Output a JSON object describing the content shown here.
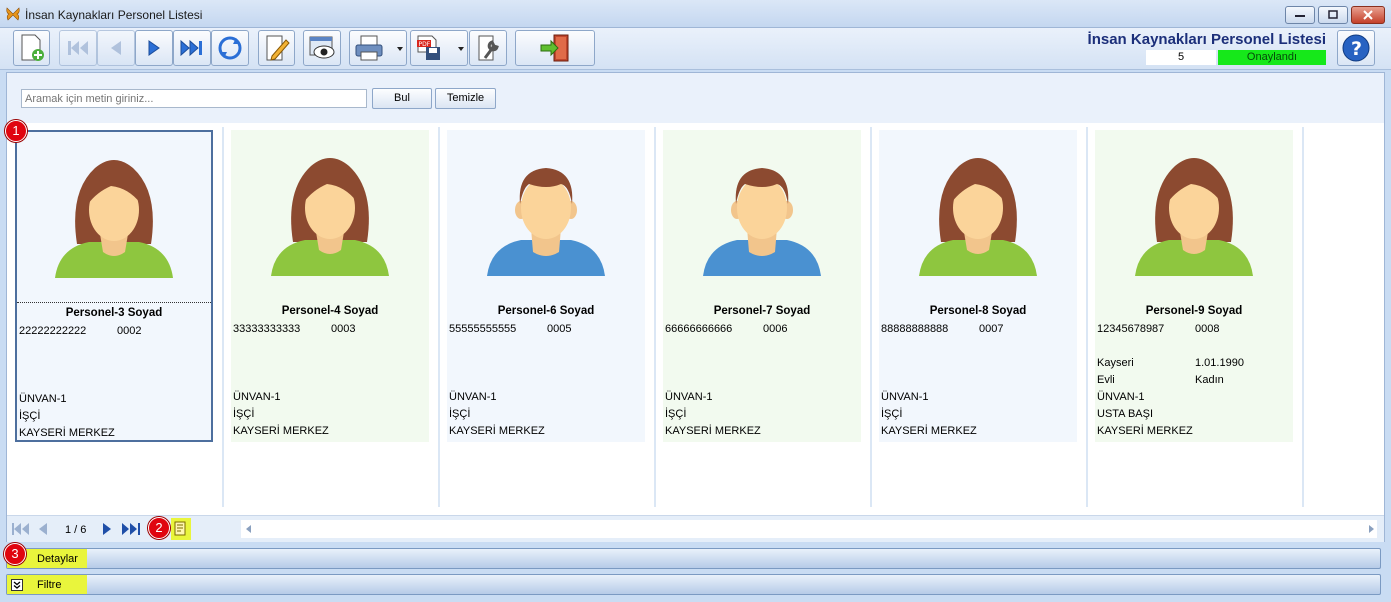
{
  "window": {
    "title": "İnsan Kaynakları Personel Listesi"
  },
  "header": {
    "heading": "İnsan Kaynakları Personel Listesi",
    "record_number": "5",
    "status": "Onaylandı"
  },
  "toolbar": {
    "buttons": [
      "new-record",
      "first",
      "previous",
      "next",
      "last",
      "refresh",
      "edit",
      "preview",
      "print",
      "pdf-export",
      "settings",
      "exit"
    ]
  },
  "search": {
    "placeholder": "Aramak için metin giriniz...",
    "find_label": "Bul",
    "clear_label": "Temizle"
  },
  "cards": [
    {
      "name": "Personel-3 Soyad",
      "id_no": "22222222222",
      "code": "0002",
      "city": "",
      "date": "",
      "marital": "",
      "gender": "",
      "title": "ÜNVAN-1",
      "position": "İŞÇİ",
      "department": "KAYSERİ MERKEZ",
      "avatar": "female-avatar-icon"
    },
    {
      "name": "Personel-4 Soyad",
      "id_no": "33333333333",
      "code": "0003",
      "city": "",
      "date": "",
      "marital": "",
      "gender": "",
      "title": "ÜNVAN-1",
      "position": "İŞÇİ",
      "department": "KAYSERİ MERKEZ",
      "avatar": "female-avatar-icon"
    },
    {
      "name": "Personel-6 Soyad",
      "id_no": "55555555555",
      "code": "0005",
      "city": "",
      "date": "",
      "marital": "",
      "gender": "",
      "title": "ÜNVAN-1",
      "position": "İŞÇİ",
      "department": "KAYSERİ MERKEZ",
      "avatar": "male-avatar-icon"
    },
    {
      "name": "Personel-7 Soyad",
      "id_no": "66666666666",
      "code": "0006",
      "city": "",
      "date": "",
      "marital": "",
      "gender": "",
      "title": "ÜNVAN-1",
      "position": "İŞÇİ",
      "department": "KAYSERİ MERKEZ",
      "avatar": "male-avatar-icon"
    },
    {
      "name": "Personel-8 Soyad",
      "id_no": "88888888888",
      "code": "0007",
      "city": "",
      "date": "",
      "marital": "",
      "gender": "",
      "title": "ÜNVAN-1",
      "position": "İŞÇİ",
      "department": "KAYSERİ MERKEZ",
      "avatar": "female-avatar-icon"
    },
    {
      "name": "Personel-9 Soyad",
      "id_no": "12345678987",
      "code": "0008",
      "city": "Kayseri",
      "date": "1.01.1990",
      "marital": "Evli",
      "gender": "Kadın",
      "title": "ÜNVAN-1",
      "position": "USTA BAŞI",
      "department": "KAYSERİ MERKEZ",
      "avatar": "female-avatar-icon"
    }
  ],
  "navigator": {
    "page_indicator": "1 / 6"
  },
  "panels": {
    "details_label": "Detaylar",
    "filter_label": "Filtre"
  },
  "callouts": [
    "1",
    "2",
    "3"
  ],
  "colors": {
    "status_green": "#16e81a",
    "heading_blue": "#1c2f7a",
    "callout_red": "#e0050f",
    "highlight_yellow": "#e9f53c"
  }
}
